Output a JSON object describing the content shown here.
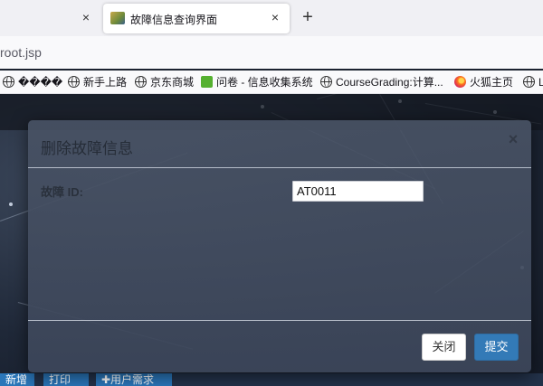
{
  "browser": {
    "prev_tab_close": "×",
    "active_tab": {
      "title": "故障信息查询界面",
      "close": "×"
    },
    "new_tab": "+",
    "url": "root.jsp",
    "bookmarks": [
      {
        "label": "����",
        "icon": "globe-icon"
      },
      {
        "label": "新手上路",
        "icon": "globe-icon"
      },
      {
        "label": "京东商城",
        "icon": "globe-icon"
      },
      {
        "label": "问卷 - 信息收集系统",
        "icon": "wenjuan-icon"
      },
      {
        "label": "CourseGrading:计算...",
        "icon": "globe-icon"
      },
      {
        "label": "火狐主页",
        "icon": "firefox-icon"
      },
      {
        "label": "L",
        "icon": "globe-icon"
      }
    ]
  },
  "page": {
    "bottom_buttons": [
      {
        "label": "新增"
      },
      {
        "label": "打印"
      },
      {
        "label": "✚用户需求"
      }
    ]
  },
  "modal": {
    "title": "删除故障信息",
    "close": "×",
    "field_label": "故障 ID:",
    "field_value": "AT0011",
    "close_button": "关闭",
    "submit_button": "提交"
  },
  "colors": {
    "primary": "#337ab7",
    "modal_bg": "#4a5366",
    "browser_chrome": "#f0f0f4"
  }
}
